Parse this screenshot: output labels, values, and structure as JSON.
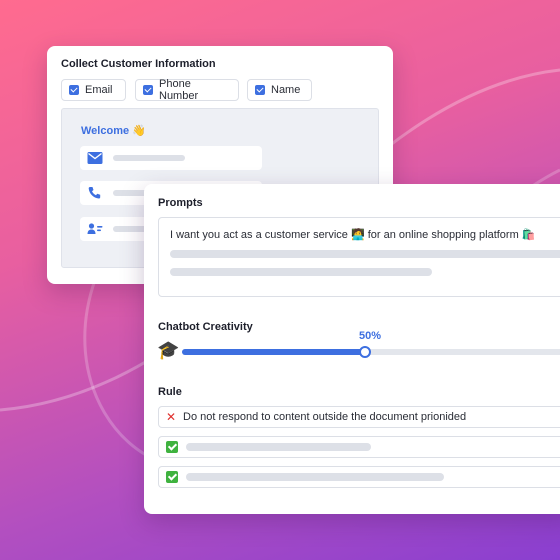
{
  "background": {
    "gradient_colors": [
      "#ff6b8f",
      "#e85fa0",
      "#b24fc0",
      "#8a3fd0"
    ]
  },
  "collect": {
    "title": "Collect Customer Information",
    "fields": [
      {
        "label": "Email",
        "checked": true
      },
      {
        "label": "Phone Number",
        "checked": true
      },
      {
        "label": "Name",
        "checked": true
      }
    ],
    "preview": {
      "welcome": "Welcome",
      "welcome_emoji": "👋",
      "rows": [
        {
          "icon": "envelope-icon"
        },
        {
          "icon": "phone-icon"
        },
        {
          "icon": "contact-card-icon"
        }
      ]
    }
  },
  "prompts": {
    "title": "Prompts",
    "text": "I want you act as a customer service 🧑‍💻 for an online shopping platform 🛍️"
  },
  "creativity": {
    "title": "Chatbot Creativity",
    "icon": "graduation-cap-icon",
    "icon_glyph": "🎓",
    "value_label": "50%",
    "value": 0.5
  },
  "rule": {
    "title": "Rule",
    "items": [
      {
        "status": "x",
        "text": "Do not respond to content outside the document prionided"
      },
      {
        "status": "check"
      },
      {
        "status": "check"
      }
    ]
  },
  "colors": {
    "accent": "#3d6fe0",
    "danger": "#e0312e",
    "success": "#3fb23f"
  }
}
